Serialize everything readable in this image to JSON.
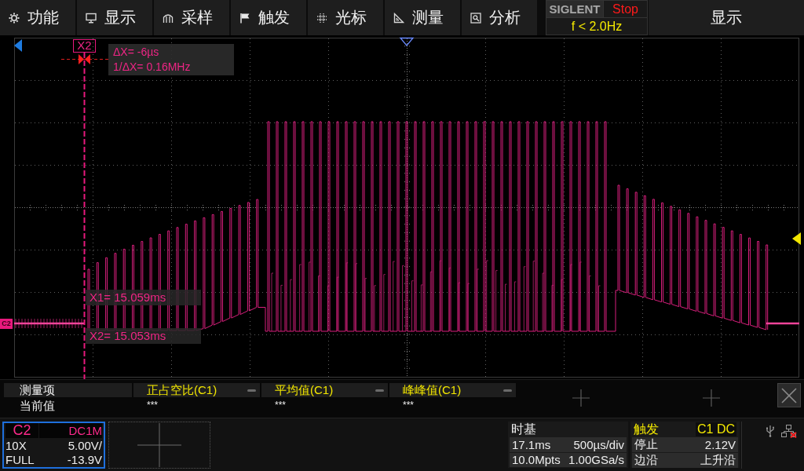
{
  "menu_bar": {
    "items": [
      {
        "label": "功能"
      },
      {
        "label": "显示"
      },
      {
        "label": "采样"
      },
      {
        "label": "触发"
      },
      {
        "label": "光标"
      },
      {
        "label": "测量"
      },
      {
        "label": "分析"
      }
    ]
  },
  "status": {
    "brand": "SIGLENT",
    "run_state": "Stop",
    "trigger_frequency": "f < 2.0Hz"
  },
  "side_panel": {
    "title": "显示"
  },
  "waveform_area": {
    "channel_marker": "C2",
    "cursor": {
      "label": "X2",
      "readouts": [
        "ΔX= -6µs",
        "1/ΔX= 0.16MHz"
      ]
    },
    "cursor_values": [
      "X1= 15.059ms",
      "X2= 15.053ms"
    ]
  },
  "measurements": {
    "row_labels": [
      "测量项",
      "当前值"
    ],
    "slots": [
      {
        "kind": "measure",
        "name": "正占空比(C1)",
        "value": "***"
      },
      {
        "kind": "measure",
        "name": "平均值(C1)",
        "value": "***"
      },
      {
        "kind": "measure",
        "name": "峰峰值(C1)",
        "value": "***"
      },
      {
        "kind": "empty"
      },
      {
        "kind": "empty"
      }
    ]
  },
  "channel": {
    "name": "C2",
    "coupling": "DC1M",
    "probe": "10X",
    "scale": "5.00V/",
    "bandwidth": "FULL",
    "offset": "-13.9V"
  },
  "timebase": {
    "title": "时基",
    "delay": "17.1ms",
    "scale": "500µs/div",
    "memory_depth": "10.0Mpts",
    "sample_rate": "1.00GSa/s"
  },
  "trigger": {
    "title": "触发",
    "source": "C1 DC",
    "mode": "停止",
    "trigger_level": "2.12V",
    "type": "边沿",
    "slope": "上升沿"
  },
  "network": {
    "connected": false
  }
}
